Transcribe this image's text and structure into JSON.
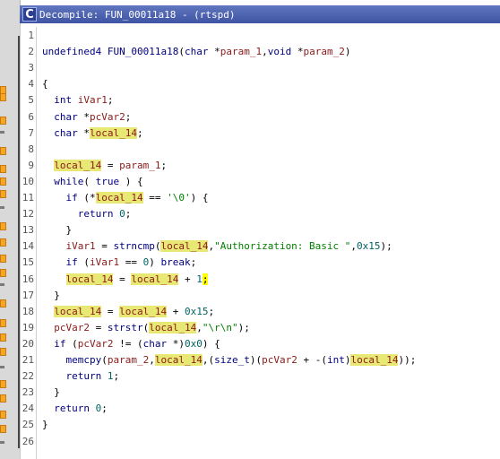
{
  "window": {
    "title": "Decompile: FUN_00011a18 -  (rtspd)",
    "icon": "decompiler-icon"
  },
  "editor": {
    "line_numbers": [
      "1",
      "2",
      "3",
      "4",
      "5",
      "6",
      "7",
      "8",
      "9",
      "10",
      "11",
      "12",
      "13",
      "14",
      "15",
      "16",
      "17",
      "18",
      "19",
      "20",
      "21",
      "22",
      "23",
      "24",
      "25",
      "26"
    ],
    "lines": [
      "",
      "undefined4 FUN_00011a18(char *param_1,void *param_2)",
      "",
      "{",
      "  int iVar1;",
      "  char *pcVar2;",
      "  char *local_14;",
      "",
      "  local_14 = param_1;",
      "  while( true ) {",
      "    if (*local_14 == '\\0') {",
      "      return 0;",
      "    }",
      "    iVar1 = strncmp(local_14,\"Authorization: Basic \",0x15);",
      "    if (iVar1 == 0) break;",
      "    local_14 = local_14 + 1;",
      "  }",
      "  local_14 = local_14 + 0x15;",
      "  pcVar2 = strstr(local_14,\"\\r\\n\");",
      "  if (pcVar2 != (char *)0x0) {",
      "    memcpy(param_2,local_14,(size_t)(pcVar2 + -(int)local_14));",
      "    return 1;",
      "  }",
      "  return 0;",
      "}",
      ""
    ],
    "highlighted_token": "local_14",
    "cursor_char": ";"
  },
  "colors": {
    "title_bg": "#4a5fae",
    "keyword": "#000080",
    "string": "#008000",
    "variable": "#8b1a1a",
    "highlight": "#e8e874"
  }
}
